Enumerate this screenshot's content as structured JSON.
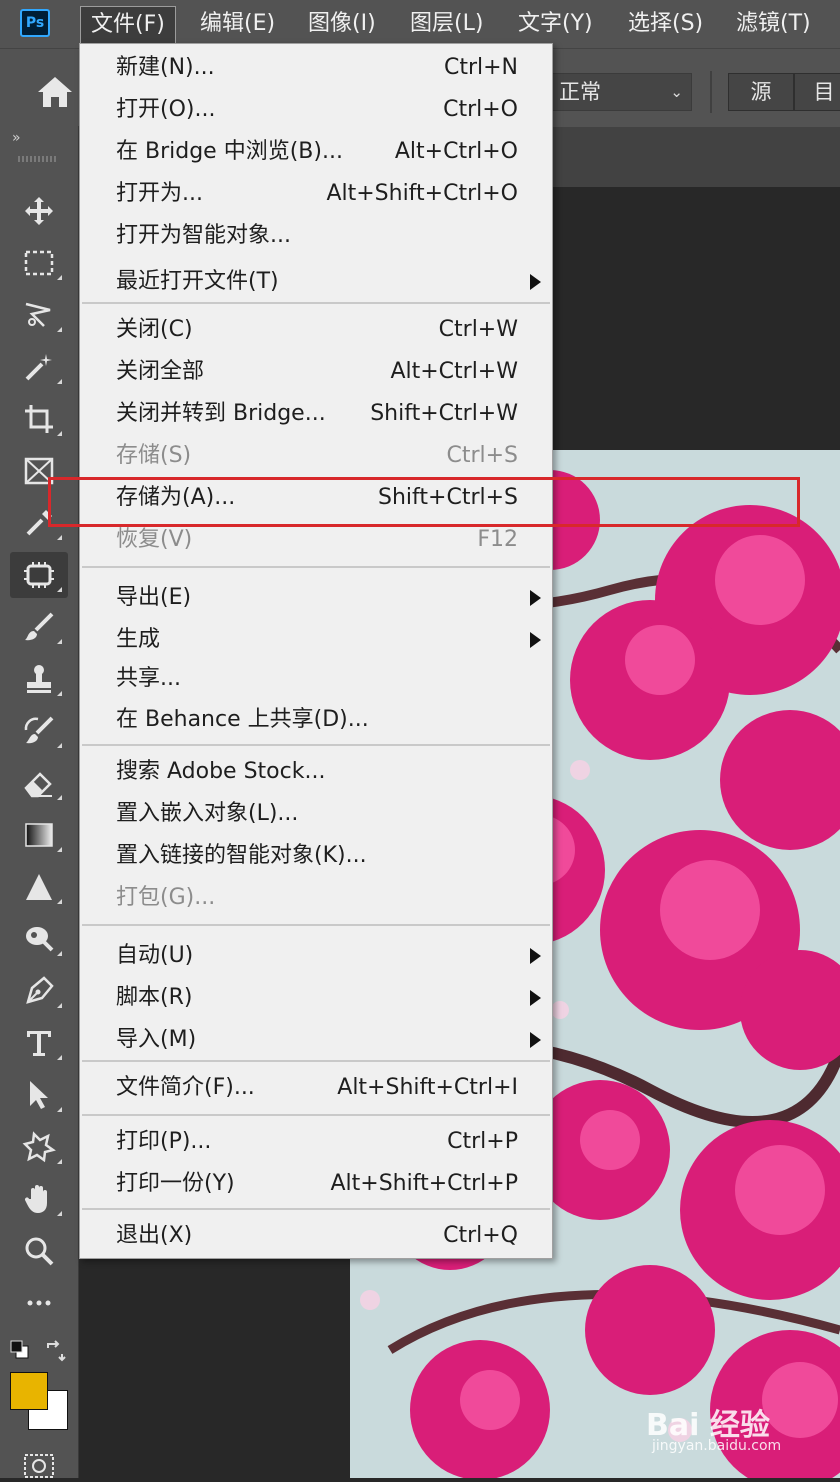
{
  "menubar": {
    "logo": "Ps",
    "items": [
      "文件(F)",
      "编辑(E)",
      "图像(I)",
      "图层(L)",
      "文字(Y)",
      "选择(S)",
      "滤镜(T)"
    ]
  },
  "options": {
    "blend_mode": "正常",
    "seg1": "源",
    "seg2": "目"
  },
  "toolbar": {
    "collapse": "»"
  },
  "file_menu": {
    "items": [
      {
        "label": "新建(N)...",
        "shortcut": "Ctrl+N"
      },
      {
        "label": "打开(O)...",
        "shortcut": "Ctrl+O"
      },
      {
        "label": "在 Bridge 中浏览(B)...",
        "shortcut": "Alt+Ctrl+O"
      },
      {
        "label": "打开为...",
        "shortcut": "Alt+Shift+Ctrl+O"
      },
      {
        "label": "打开为智能对象...",
        "shortcut": ""
      },
      {
        "label": "最近打开文件(T)",
        "shortcut": ""
      },
      {
        "label": "关闭(C)",
        "shortcut": "Ctrl+W"
      },
      {
        "label": "关闭全部",
        "shortcut": "Alt+Ctrl+W"
      },
      {
        "label": "关闭并转到 Bridge...",
        "shortcut": "Shift+Ctrl+W"
      },
      {
        "label": "存储(S)",
        "shortcut": "Ctrl+S"
      },
      {
        "label": "存储为(A)...",
        "shortcut": "Shift+Ctrl+S"
      },
      {
        "label": "恢复(V)",
        "shortcut": "F12"
      },
      {
        "label": "导出(E)",
        "shortcut": ""
      },
      {
        "label": "生成",
        "shortcut": ""
      },
      {
        "label": "共享...",
        "shortcut": ""
      },
      {
        "label": "在 Behance 上共享(D)...",
        "shortcut": ""
      },
      {
        "label": "搜索 Adobe Stock...",
        "shortcut": ""
      },
      {
        "label": "置入嵌入对象(L)...",
        "shortcut": ""
      },
      {
        "label": "置入链接的智能对象(K)...",
        "shortcut": ""
      },
      {
        "label": "打包(G)...",
        "shortcut": ""
      },
      {
        "label": "自动(U)",
        "shortcut": ""
      },
      {
        "label": "脚本(R)",
        "shortcut": ""
      },
      {
        "label": "导入(M)",
        "shortcut": ""
      },
      {
        "label": "文件简介(F)...",
        "shortcut": "Alt+Shift+Ctrl+I"
      },
      {
        "label": "打印(P)...",
        "shortcut": "Ctrl+P"
      },
      {
        "label": "打印一份(Y)",
        "shortcut": "Alt+Shift+Ctrl+P"
      },
      {
        "label": "退出(X)",
        "shortcut": "Ctrl+Q"
      }
    ]
  },
  "colors": {
    "foreground": "#e8b400",
    "background": "#ffffff",
    "highlight": "#d8282b"
  },
  "watermark": {
    "logo": "Bai 经验",
    "url": "jingyan.baidu.com"
  }
}
